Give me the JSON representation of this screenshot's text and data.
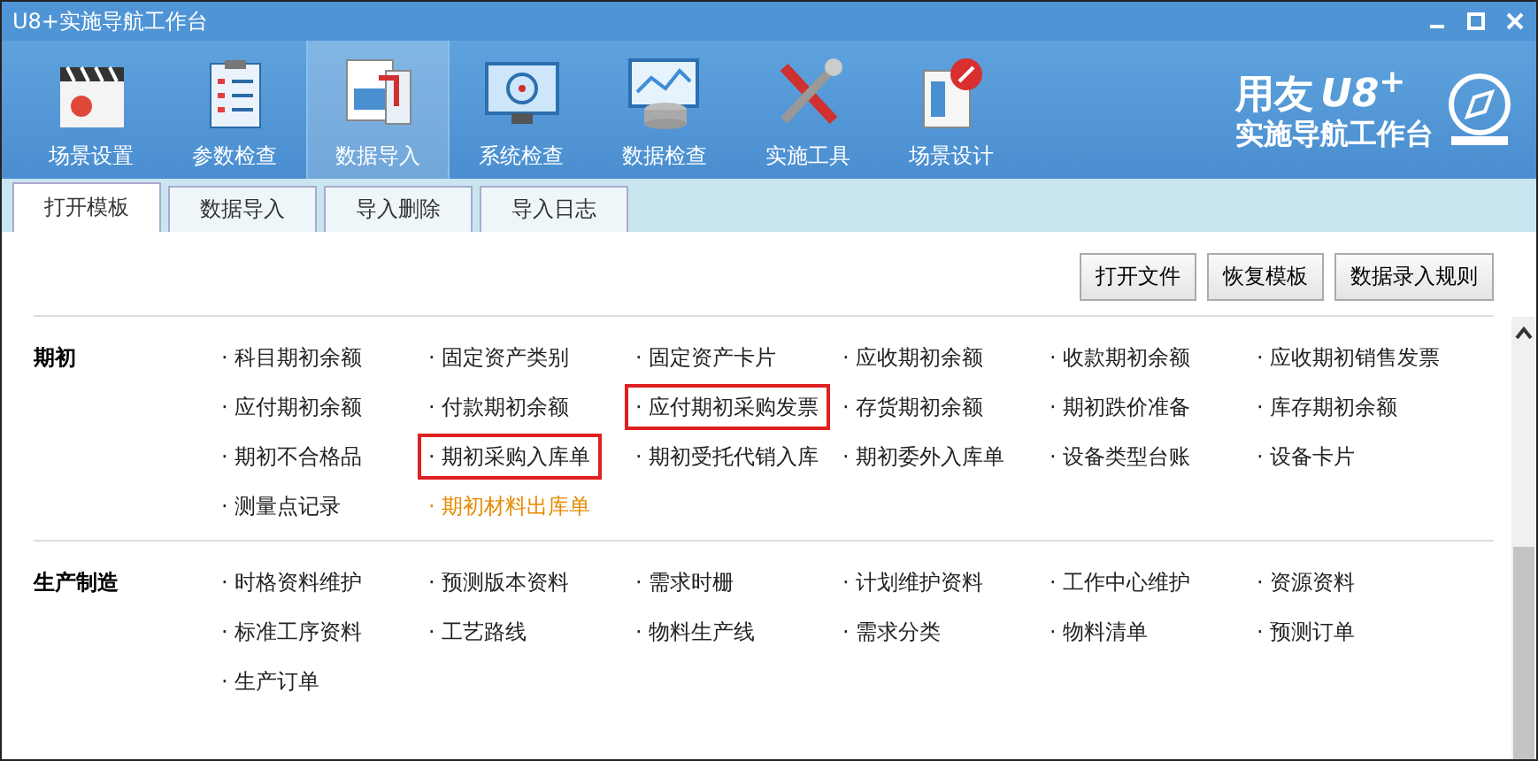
{
  "window": {
    "title": "U8+实施导航工作台"
  },
  "toolbar": [
    {
      "label": "场景设置",
      "selected": false
    },
    {
      "label": "参数检查",
      "selected": false
    },
    {
      "label": "数据导入",
      "selected": true
    },
    {
      "label": "系统检查",
      "selected": false
    },
    {
      "label": "数据检查",
      "selected": false
    },
    {
      "label": "实施工具",
      "selected": false
    },
    {
      "label": "场景设计",
      "selected": false
    }
  ],
  "logo": {
    "brand": "用友",
    "product": "U8",
    "plus": "+",
    "subtitle": "实施导航工作台"
  },
  "tabs": [
    {
      "label": "打开模板",
      "selected": true
    },
    {
      "label": "数据导入",
      "selected": false
    },
    {
      "label": "导入删除",
      "selected": false
    },
    {
      "label": "导入日志",
      "selected": false
    }
  ],
  "actions": [
    "打开文件",
    "恢复模板",
    "数据录入规则"
  ],
  "sections": [
    {
      "title": "期初",
      "items": [
        {
          "label": "· 科目期初余额",
          "boxed": false,
          "active": false
        },
        {
          "label": "· 固定资产类别",
          "boxed": false,
          "active": false
        },
        {
          "label": "· 固定资产卡片",
          "boxed": false,
          "active": false
        },
        {
          "label": "· 应收期初余额",
          "boxed": false,
          "active": false
        },
        {
          "label": "· 收款期初余额",
          "boxed": false,
          "active": false
        },
        {
          "label": "· 应收期初销售发票",
          "boxed": false,
          "active": false
        },
        {
          "label": "· 应付期初余额",
          "boxed": false,
          "active": false
        },
        {
          "label": "· 付款期初余额",
          "boxed": false,
          "active": false
        },
        {
          "label": "· 应付期初采购发票",
          "boxed": true,
          "active": false
        },
        {
          "label": "· 存货期初余额",
          "boxed": false,
          "active": false
        },
        {
          "label": "· 期初跌价准备",
          "boxed": false,
          "active": false
        },
        {
          "label": "· 库存期初余额",
          "boxed": false,
          "active": false
        },
        {
          "label": "· 期初不合格品",
          "boxed": false,
          "active": false
        },
        {
          "label": "· 期初采购入库单",
          "boxed": true,
          "active": false
        },
        {
          "label": "· 期初受托代销入库",
          "boxed": false,
          "active": false
        },
        {
          "label": "· 期初委外入库单",
          "boxed": false,
          "active": false
        },
        {
          "label": "· 设备类型台账",
          "boxed": false,
          "active": false
        },
        {
          "label": "· 设备卡片",
          "boxed": false,
          "active": false
        },
        {
          "label": "· 测量点记录",
          "boxed": false,
          "active": false
        },
        {
          "label": "· 期初材料出库单",
          "boxed": false,
          "active": true
        }
      ]
    },
    {
      "title": "生产制造",
      "items": [
        {
          "label": "· 时格资料维护",
          "boxed": false,
          "active": false
        },
        {
          "label": "· 预测版本资料",
          "boxed": false,
          "active": false
        },
        {
          "label": "· 需求时栅",
          "boxed": false,
          "active": false
        },
        {
          "label": "· 计划维护资料",
          "boxed": false,
          "active": false
        },
        {
          "label": "· 工作中心维护",
          "boxed": false,
          "active": false
        },
        {
          "label": "· 资源资料",
          "boxed": false,
          "active": false
        },
        {
          "label": "· 标准工序资料",
          "boxed": false,
          "active": false
        },
        {
          "label": "· 工艺路线",
          "boxed": false,
          "active": false
        },
        {
          "label": "· 物料生产线",
          "boxed": false,
          "active": false
        },
        {
          "label": "· 需求分类",
          "boxed": false,
          "active": false
        },
        {
          "label": "· 物料清单",
          "boxed": false,
          "active": false
        },
        {
          "label": "· 预测订单",
          "boxed": false,
          "active": false
        },
        {
          "label": "· 生产订单",
          "boxed": false,
          "active": false
        }
      ]
    }
  ]
}
